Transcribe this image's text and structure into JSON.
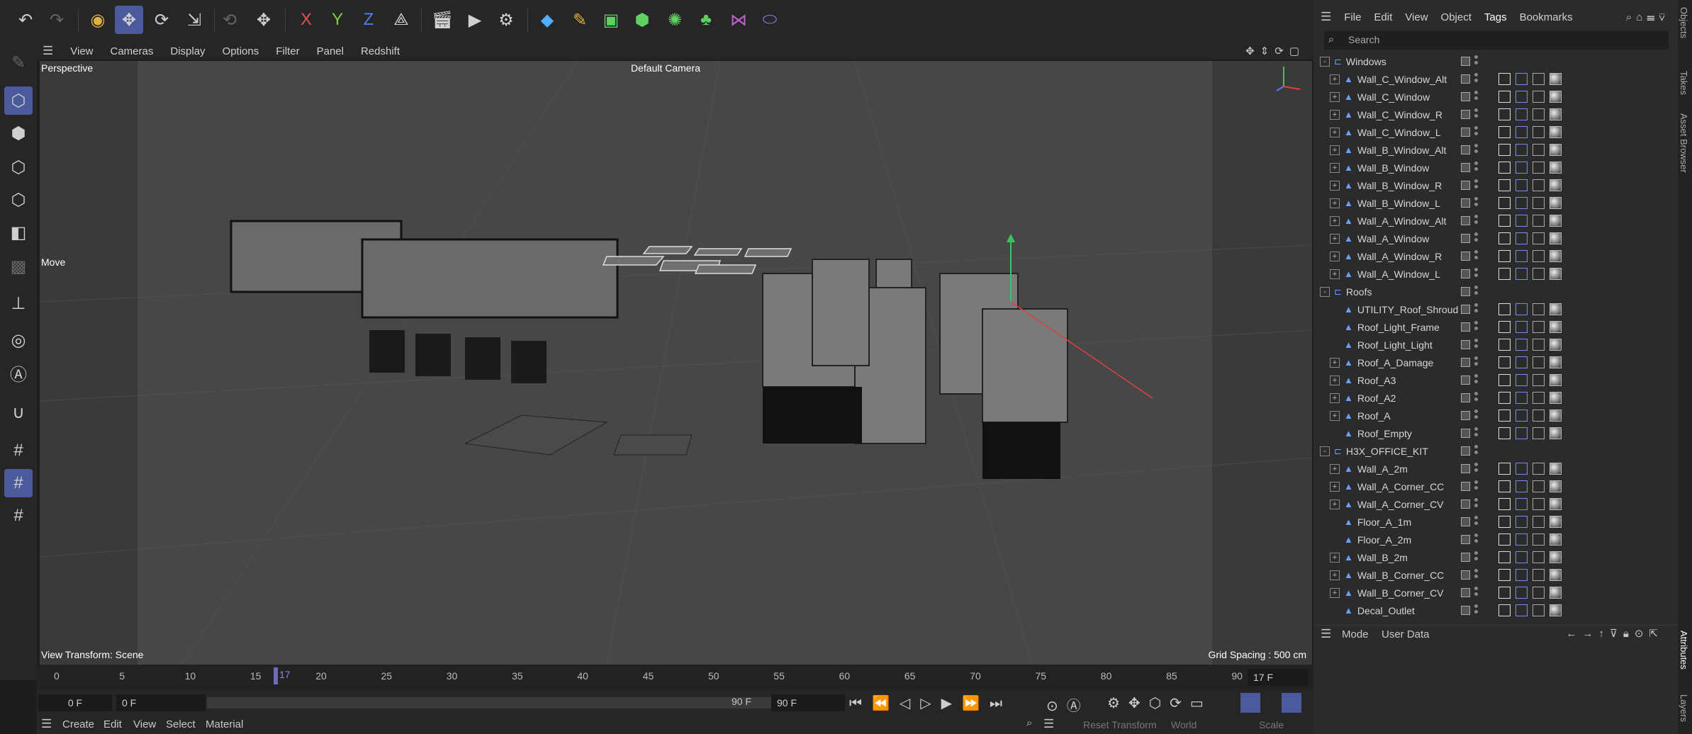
{
  "toolbar": {
    "axis_x": "X",
    "axis_y": "Y",
    "axis_z": "Z"
  },
  "viewport_menu": [
    "View",
    "Cameras",
    "Display",
    "Options",
    "Filter",
    "Panel",
    "Redshift"
  ],
  "viewport": {
    "name": "Perspective",
    "camera": "Default Camera",
    "tool": "Move",
    "transform": "View Transform: Scene",
    "grid": "Grid Spacing : 500 cm"
  },
  "object_menu": [
    "File",
    "Edit",
    "View",
    "Object",
    "Tags",
    "Bookmarks"
  ],
  "search_placeholder": "Search",
  "objects": [
    {
      "name": "Windows",
      "depth": 0,
      "expand": "-"
    },
    {
      "name": "Wall_C_Window_Alt",
      "depth": 1,
      "expand": "+"
    },
    {
      "name": "Wall_C_Window",
      "depth": 1,
      "expand": "+"
    },
    {
      "name": "Wall_C_Window_R",
      "depth": 1,
      "expand": "+"
    },
    {
      "name": "Wall_C_Window_L",
      "depth": 1,
      "expand": "+"
    },
    {
      "name": "Wall_B_Window_Alt",
      "depth": 1,
      "expand": "+"
    },
    {
      "name": "Wall_B_Window",
      "depth": 1,
      "expand": "+"
    },
    {
      "name": "Wall_B_Window_R",
      "depth": 1,
      "expand": "+"
    },
    {
      "name": "Wall_B_Window_L",
      "depth": 1,
      "expand": "+"
    },
    {
      "name": "Wall_A_Window_Alt",
      "depth": 1,
      "expand": "+"
    },
    {
      "name": "Wall_A_Window",
      "depth": 1,
      "expand": "+"
    },
    {
      "name": "Wall_A_Window_R",
      "depth": 1,
      "expand": "+"
    },
    {
      "name": "Wall_A_Window_L",
      "depth": 1,
      "expand": "+"
    },
    {
      "name": "Roofs",
      "depth": 0,
      "expand": "-"
    },
    {
      "name": "UTILITY_Roof_Shroud",
      "depth": 1,
      "expand": ""
    },
    {
      "name": "Roof_Light_Frame",
      "depth": 1,
      "expand": ""
    },
    {
      "name": "Roof_Light_Light",
      "depth": 1,
      "expand": ""
    },
    {
      "name": "Roof_A_Damage",
      "depth": 1,
      "expand": "+"
    },
    {
      "name": "Roof_A3",
      "depth": 1,
      "expand": "+"
    },
    {
      "name": "Roof_A2",
      "depth": 1,
      "expand": "+"
    },
    {
      "name": "Roof_A",
      "depth": 1,
      "expand": "+"
    },
    {
      "name": "Roof_Empty",
      "depth": 1,
      "expand": ""
    },
    {
      "name": "H3X_OFFICE_KIT",
      "depth": 0,
      "expand": "-"
    },
    {
      "name": "Wall_A_2m",
      "depth": 1,
      "expand": "+"
    },
    {
      "name": "Wall_A_Corner_CC",
      "depth": 1,
      "expand": "+"
    },
    {
      "name": "Wall_A_Corner_CV",
      "depth": 1,
      "expand": "+"
    },
    {
      "name": "Floor_A_1m",
      "depth": 1,
      "expand": ""
    },
    {
      "name": "Floor_A_2m",
      "depth": 1,
      "expand": ""
    },
    {
      "name": "Wall_B_2m",
      "depth": 1,
      "expand": "+"
    },
    {
      "name": "Wall_B_Corner_CC",
      "depth": 1,
      "expand": "+"
    },
    {
      "name": "Wall_B_Corner_CV",
      "depth": 1,
      "expand": "+"
    },
    {
      "name": "Decal_Outlet",
      "depth": 1,
      "expand": ""
    }
  ],
  "side_tabs": {
    "objects": "Objects",
    "takes": "Takes",
    "asset_browser": "Asset Browser",
    "attributes": "Attributes",
    "layers": "Layers"
  },
  "attr_menu": [
    "Mode",
    "User Data"
  ],
  "timeline": {
    "ticks": [
      "0",
      "5",
      "10",
      "15",
      "20",
      "25",
      "30",
      "35",
      "40",
      "45",
      "50",
      "55",
      "60",
      "65",
      "70",
      "75",
      "80",
      "85",
      "90"
    ],
    "playhead": "17",
    "current_frame": "17 F"
  },
  "transport": {
    "start": "0 F",
    "range_start": "0 F",
    "range_end": "90 F",
    "end": "90 F"
  },
  "bottom_menu": [
    "Create",
    "Edit",
    "View",
    "Select",
    "Material"
  ],
  "bottom_right": {
    "reset": "Reset Transform",
    "world": "World",
    "scale": "Scale"
  }
}
